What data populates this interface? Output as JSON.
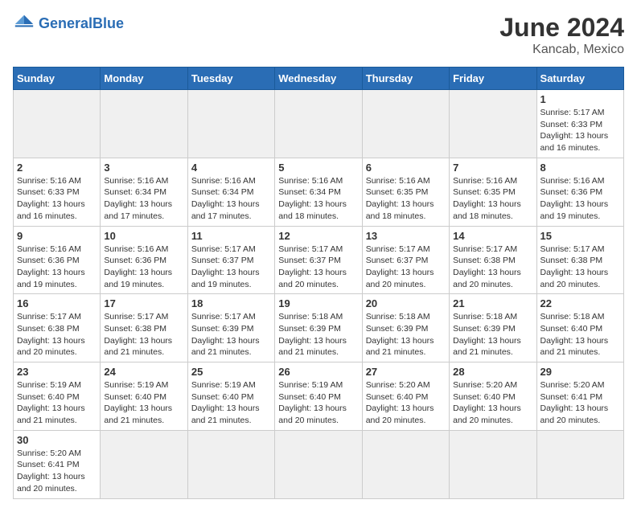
{
  "header": {
    "logo_general": "General",
    "logo_blue": "Blue",
    "title": "June 2024",
    "location": "Kancab, Mexico"
  },
  "weekdays": [
    "Sunday",
    "Monday",
    "Tuesday",
    "Wednesday",
    "Thursday",
    "Friday",
    "Saturday"
  ],
  "days": [
    {
      "num": "",
      "empty": true
    },
    {
      "num": "",
      "empty": true
    },
    {
      "num": "",
      "empty": true
    },
    {
      "num": "",
      "empty": true
    },
    {
      "num": "",
      "empty": true
    },
    {
      "num": "",
      "empty": true
    },
    {
      "num": "1",
      "sunrise": "Sunrise: 5:17 AM",
      "sunset": "Sunset: 6:33 PM",
      "daylight": "Daylight: 13 hours and 16 minutes."
    },
    {
      "num": "2",
      "sunrise": "Sunrise: 5:16 AM",
      "sunset": "Sunset: 6:33 PM",
      "daylight": "Daylight: 13 hours and 16 minutes."
    },
    {
      "num": "3",
      "sunrise": "Sunrise: 5:16 AM",
      "sunset": "Sunset: 6:34 PM",
      "daylight": "Daylight: 13 hours and 17 minutes."
    },
    {
      "num": "4",
      "sunrise": "Sunrise: 5:16 AM",
      "sunset": "Sunset: 6:34 PM",
      "daylight": "Daylight: 13 hours and 17 minutes."
    },
    {
      "num": "5",
      "sunrise": "Sunrise: 5:16 AM",
      "sunset": "Sunset: 6:34 PM",
      "daylight": "Daylight: 13 hours and 18 minutes."
    },
    {
      "num": "6",
      "sunrise": "Sunrise: 5:16 AM",
      "sunset": "Sunset: 6:35 PM",
      "daylight": "Daylight: 13 hours and 18 minutes."
    },
    {
      "num": "7",
      "sunrise": "Sunrise: 5:16 AM",
      "sunset": "Sunset: 6:35 PM",
      "daylight": "Daylight: 13 hours and 18 minutes."
    },
    {
      "num": "8",
      "sunrise": "Sunrise: 5:16 AM",
      "sunset": "Sunset: 6:36 PM",
      "daylight": "Daylight: 13 hours and 19 minutes."
    },
    {
      "num": "9",
      "sunrise": "Sunrise: 5:16 AM",
      "sunset": "Sunset: 6:36 PM",
      "daylight": "Daylight: 13 hours and 19 minutes."
    },
    {
      "num": "10",
      "sunrise": "Sunrise: 5:16 AM",
      "sunset": "Sunset: 6:36 PM",
      "daylight": "Daylight: 13 hours and 19 minutes."
    },
    {
      "num": "11",
      "sunrise": "Sunrise: 5:17 AM",
      "sunset": "Sunset: 6:37 PM",
      "daylight": "Daylight: 13 hours and 19 minutes."
    },
    {
      "num": "12",
      "sunrise": "Sunrise: 5:17 AM",
      "sunset": "Sunset: 6:37 PM",
      "daylight": "Daylight: 13 hours and 20 minutes."
    },
    {
      "num": "13",
      "sunrise": "Sunrise: 5:17 AM",
      "sunset": "Sunset: 6:37 PM",
      "daylight": "Daylight: 13 hours and 20 minutes."
    },
    {
      "num": "14",
      "sunrise": "Sunrise: 5:17 AM",
      "sunset": "Sunset: 6:38 PM",
      "daylight": "Daylight: 13 hours and 20 minutes."
    },
    {
      "num": "15",
      "sunrise": "Sunrise: 5:17 AM",
      "sunset": "Sunset: 6:38 PM",
      "daylight": "Daylight: 13 hours and 20 minutes."
    },
    {
      "num": "16",
      "sunrise": "Sunrise: 5:17 AM",
      "sunset": "Sunset: 6:38 PM",
      "daylight": "Daylight: 13 hours and 20 minutes."
    },
    {
      "num": "17",
      "sunrise": "Sunrise: 5:17 AM",
      "sunset": "Sunset: 6:38 PM",
      "daylight": "Daylight: 13 hours and 21 minutes."
    },
    {
      "num": "18",
      "sunrise": "Sunrise: 5:17 AM",
      "sunset": "Sunset: 6:39 PM",
      "daylight": "Daylight: 13 hours and 21 minutes."
    },
    {
      "num": "19",
      "sunrise": "Sunrise: 5:18 AM",
      "sunset": "Sunset: 6:39 PM",
      "daylight": "Daylight: 13 hours and 21 minutes."
    },
    {
      "num": "20",
      "sunrise": "Sunrise: 5:18 AM",
      "sunset": "Sunset: 6:39 PM",
      "daylight": "Daylight: 13 hours and 21 minutes."
    },
    {
      "num": "21",
      "sunrise": "Sunrise: 5:18 AM",
      "sunset": "Sunset: 6:39 PM",
      "daylight": "Daylight: 13 hours and 21 minutes."
    },
    {
      "num": "22",
      "sunrise": "Sunrise: 5:18 AM",
      "sunset": "Sunset: 6:40 PM",
      "daylight": "Daylight: 13 hours and 21 minutes."
    },
    {
      "num": "23",
      "sunrise": "Sunrise: 5:19 AM",
      "sunset": "Sunset: 6:40 PM",
      "daylight": "Daylight: 13 hours and 21 minutes."
    },
    {
      "num": "24",
      "sunrise": "Sunrise: 5:19 AM",
      "sunset": "Sunset: 6:40 PM",
      "daylight": "Daylight: 13 hours and 21 minutes."
    },
    {
      "num": "25",
      "sunrise": "Sunrise: 5:19 AM",
      "sunset": "Sunset: 6:40 PM",
      "daylight": "Daylight: 13 hours and 21 minutes."
    },
    {
      "num": "26",
      "sunrise": "Sunrise: 5:19 AM",
      "sunset": "Sunset: 6:40 PM",
      "daylight": "Daylight: 13 hours and 20 minutes."
    },
    {
      "num": "27",
      "sunrise": "Sunrise: 5:20 AM",
      "sunset": "Sunset: 6:40 PM",
      "daylight": "Daylight: 13 hours and 20 minutes."
    },
    {
      "num": "28",
      "sunrise": "Sunrise: 5:20 AM",
      "sunset": "Sunset: 6:40 PM",
      "daylight": "Daylight: 13 hours and 20 minutes."
    },
    {
      "num": "29",
      "sunrise": "Sunrise: 5:20 AM",
      "sunset": "Sunset: 6:41 PM",
      "daylight": "Daylight: 13 hours and 20 minutes."
    },
    {
      "num": "30",
      "sunrise": "Sunrise: 5:20 AM",
      "sunset": "Sunset: 6:41 PM",
      "daylight": "Daylight: 13 hours and 20 minutes."
    },
    {
      "num": "",
      "empty": true
    },
    {
      "num": "",
      "empty": true
    },
    {
      "num": "",
      "empty": true
    },
    {
      "num": "",
      "empty": true
    },
    {
      "num": "",
      "empty": true
    },
    {
      "num": "",
      "empty": true
    }
  ]
}
